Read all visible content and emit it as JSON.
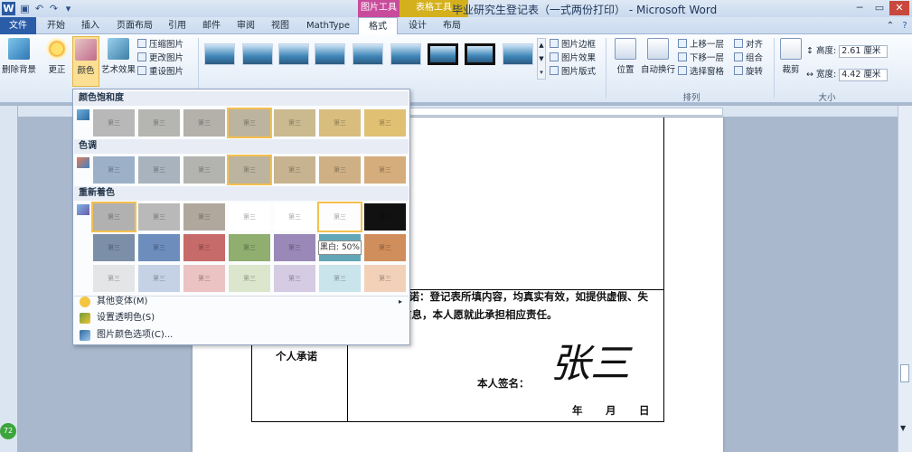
{
  "title_bar": {
    "title": "毕业研究生登记表（一式两份打印） - Microsoft Word",
    "contextual_groups": [
      {
        "label": "图片工具",
        "color": "#c94c9c"
      },
      {
        "label": "表格工具",
        "color": "#d4b11c"
      }
    ]
  },
  "tabs": {
    "file": "文件",
    "items": [
      "开始",
      "插入",
      "页面布局",
      "引用",
      "邮件",
      "审阅",
      "视图",
      "MathType"
    ],
    "contextual": [
      "格式",
      "设计",
      "布局"
    ],
    "active": "格式"
  },
  "ribbon": {
    "remove_bg": "删除背景",
    "corrections": "更正",
    "color": "颜色",
    "artistic": "艺术效果",
    "adjust_small": [
      "压缩图片",
      "更改图片",
      "重设图片"
    ],
    "style_small": [
      "图片边框",
      "图片效果",
      "图片版式"
    ],
    "position": "位置",
    "wrap": "自动换行",
    "arrange_small": [
      "上移一层",
      "下移一层",
      "选择窗格"
    ],
    "arrange_small2": [
      "对齐",
      "组合",
      "旋转"
    ],
    "arrange_label": "排列",
    "crop": "裁剪",
    "height_label": "高度:",
    "height_value": "2.61 厘米",
    "width_label": "宽度:",
    "width_value": "4.42 厘米",
    "size_label": "大小"
  },
  "dropdown": {
    "saturation_header": "颜色饱和度",
    "tone_header": "色调",
    "recolor_header": "重新着色",
    "tooltip": "黑白: 50%",
    "menu": [
      "其他变体(M)",
      "设置透明色(S)",
      "图片颜色选项(C)..."
    ],
    "saturation_colors": [
      "#b8b8b8",
      "#b5b5b1",
      "#b3b1aa",
      "#bcb49e",
      "#cbb98f",
      "#d8bd7f",
      "#e0c072"
    ],
    "tone_colors": [
      "#9cb1c8",
      "#a8b3bd",
      "#b3b4b0",
      "#bcb49e",
      "#c7b38f",
      "#cfb085",
      "#d5ad7c"
    ],
    "recolor_row1": [
      "#b1b1b1",
      "#b9b9b9",
      "#b1a89d",
      "#ffffff",
      "#ffffff",
      "#fdfdfd",
      "#111111"
    ],
    "recolor_row2": [
      "#7c8fa8",
      "#6d8dbd",
      "#c76a6a",
      "#8fae6f",
      "#9a88b8",
      "#62a7b8",
      "#d08e5c"
    ],
    "recolor_row3": [
      "#e3e5e7",
      "#c5d2e6",
      "#ecc3c3",
      "#dbe6cc",
      "#d5cce3",
      "#c9e4ea",
      "#f3d1b8"
    ],
    "swatch_text": "第三"
  },
  "document": {
    "promise_line1": "本人承诺：登记表所填内容，均真实有效，如提供虚假、失",
    "promise_line2": "实的填报信息，本人愿就此承担相应责任。",
    "personal_promise": "个人承诺",
    "signature_label": "本人签名：",
    "signature": "张三",
    "date_year": "年",
    "date_month": "月",
    "date_day": "日"
  },
  "status": {
    "zoom_badge": "72"
  }
}
